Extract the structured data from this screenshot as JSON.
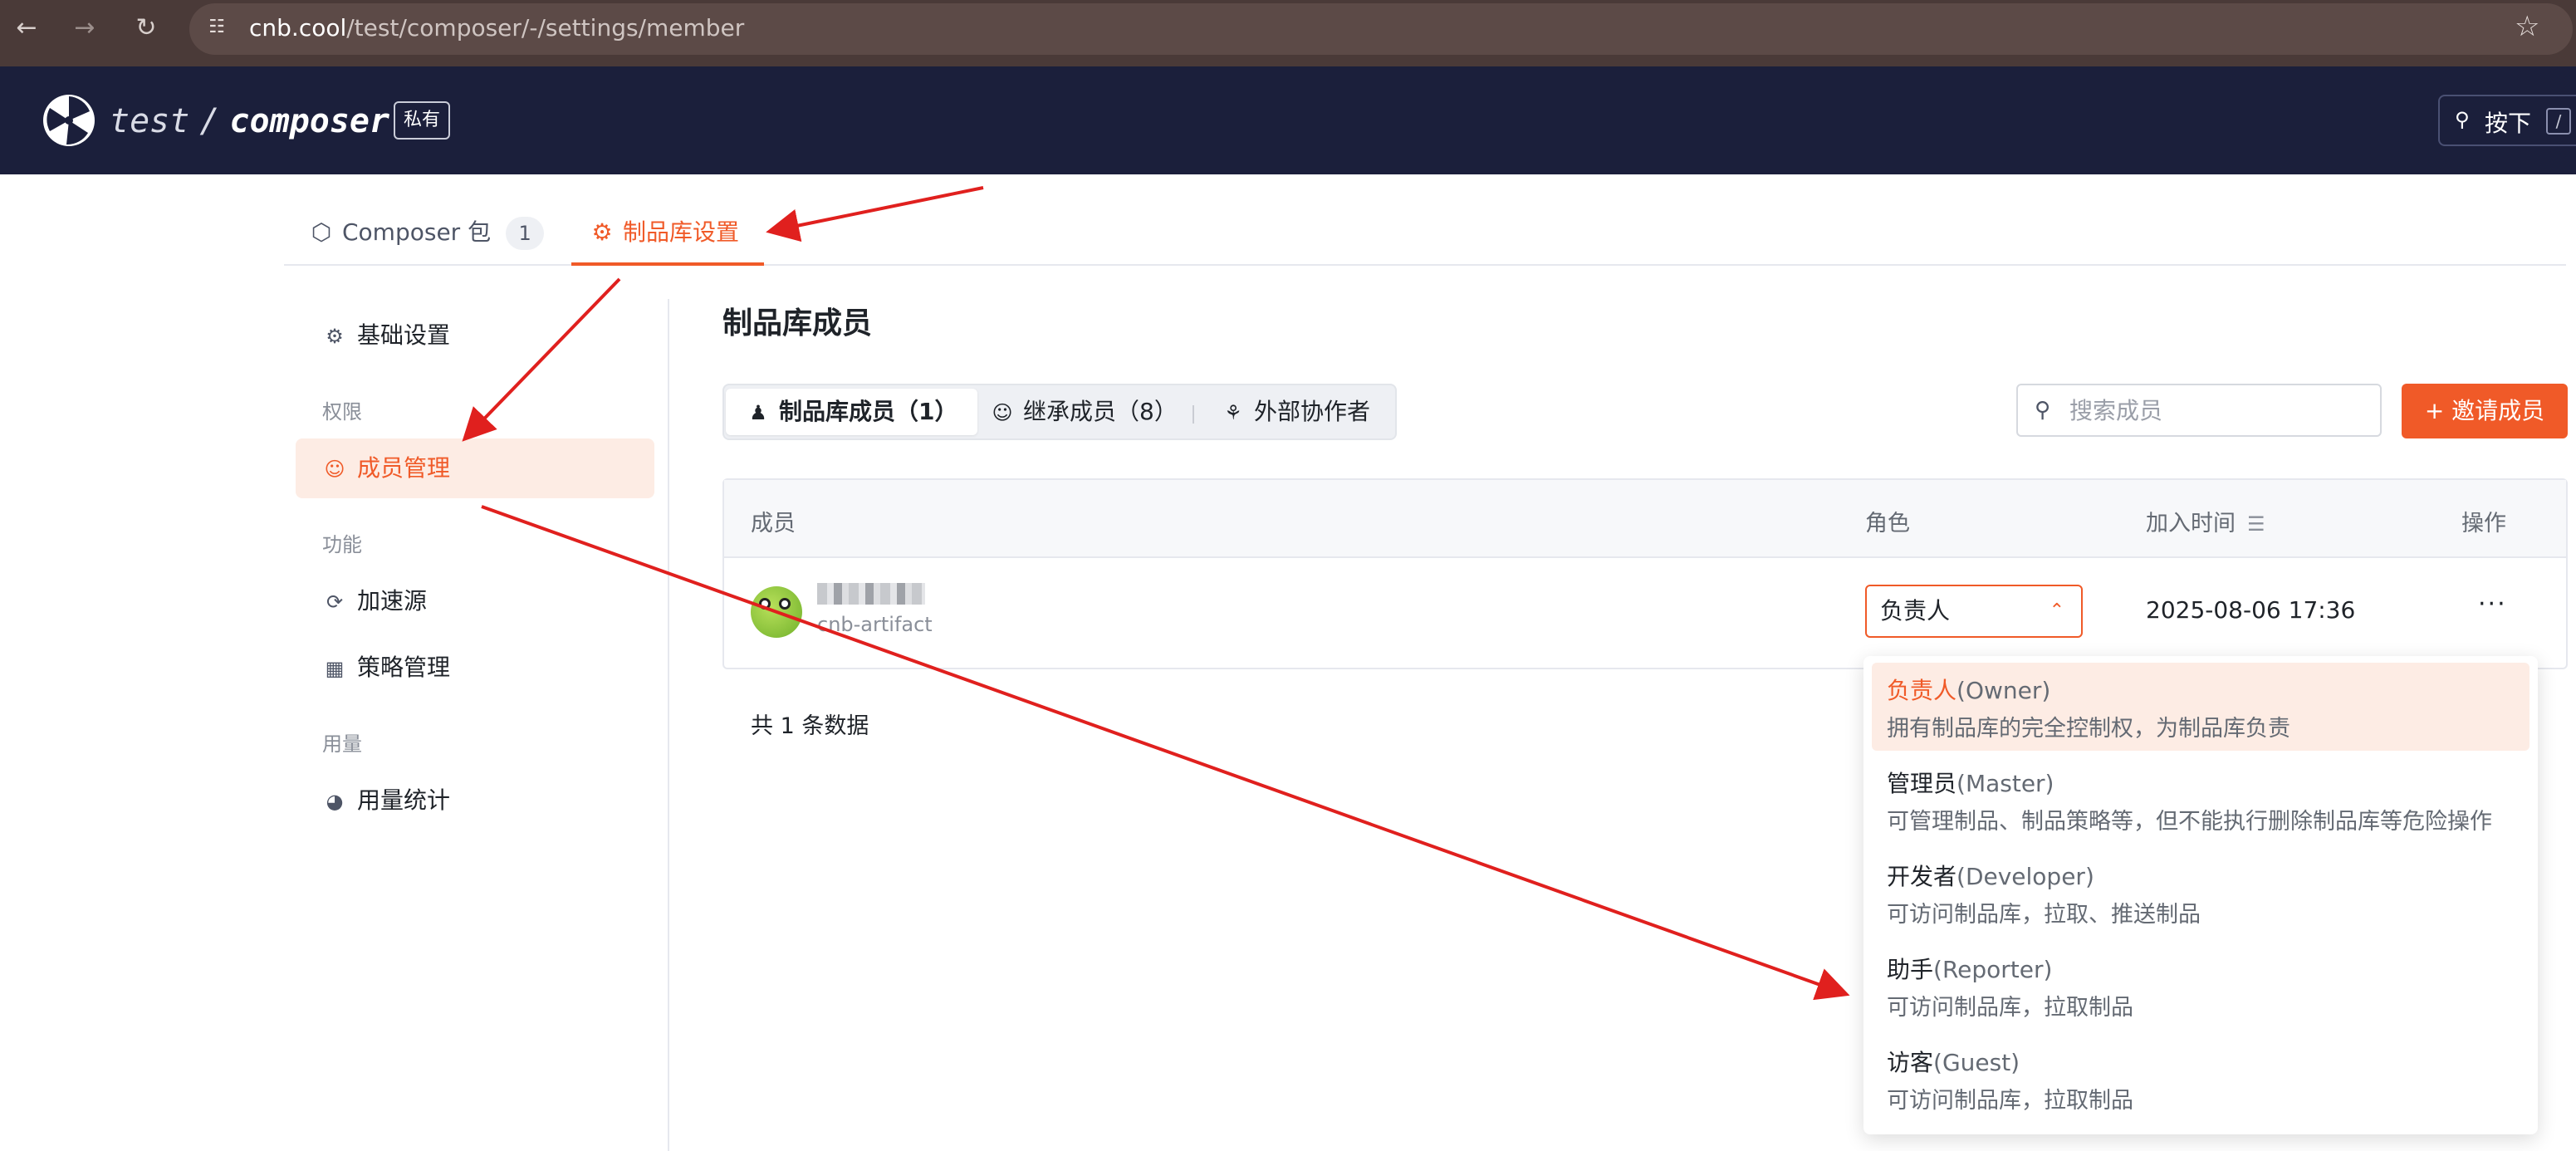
{
  "browser": {
    "url_host": "cnb.cool",
    "url_path": "/test/composer/-/settings/member"
  },
  "header": {
    "owner": "test",
    "repo": "composer",
    "visibility_badge": "私有",
    "search_label": "按下",
    "search_key": "/"
  },
  "top_tabs": [
    {
      "label": "Composer 包",
      "count": "1",
      "icon": "package-icon"
    },
    {
      "label": "制品库设置",
      "icon": "settings-icon",
      "active": true
    }
  ],
  "sidebar": {
    "basic": "基础设置",
    "group_permissions": "权限",
    "members": "成员管理",
    "group_features": "功能",
    "accelerator": "加速源",
    "policy": "策略管理",
    "group_usage": "用量",
    "usage_stats": "用量统计"
  },
  "main": {
    "title": "制品库成员",
    "segments": [
      {
        "label": "制品库成员（1）",
        "icon": "user-icon",
        "active": true
      },
      {
        "label": "继承成员（8）",
        "icon": "users-icon"
      },
      {
        "label": "外部协作者",
        "icon": "collaborator-icon"
      }
    ],
    "search_placeholder": "搜索成员",
    "invite_label": "+ 邀请成员",
    "table": {
      "col_member": "成员",
      "col_role": "角色",
      "col_joined": "加入时间",
      "col_actions": "操作",
      "rows": [
        {
          "username": "cnb-artifact",
          "role": "负责人",
          "joined": "2025-08-06 17:36",
          "actions": "···"
        }
      ]
    },
    "total": "共 1 条数据"
  },
  "role_dropdown": {
    "options": [
      {
        "zh": "负责人",
        "en": "(Owner)",
        "desc": "拥有制品库的完全控制权，为制品库负责",
        "selected": true
      },
      {
        "zh": "管理员",
        "en": "(Master)",
        "desc": "可管理制品、制品策略等，但不能执行删除制品库等危险操作"
      },
      {
        "zh": "开发者",
        "en": "(Developer)",
        "desc": "可访问制品库，拉取、推送制品"
      },
      {
        "zh": "助手",
        "en": "(Reporter)",
        "desc": "可访问制品库，拉取制品"
      },
      {
        "zh": "访客",
        "en": "(Guest)",
        "desc": "可访问制品库，拉取制品"
      }
    ]
  },
  "colors": {
    "accent": "#f05a28",
    "header_bg": "#1b1f3b",
    "annotation_arrow": "#e0201e"
  }
}
